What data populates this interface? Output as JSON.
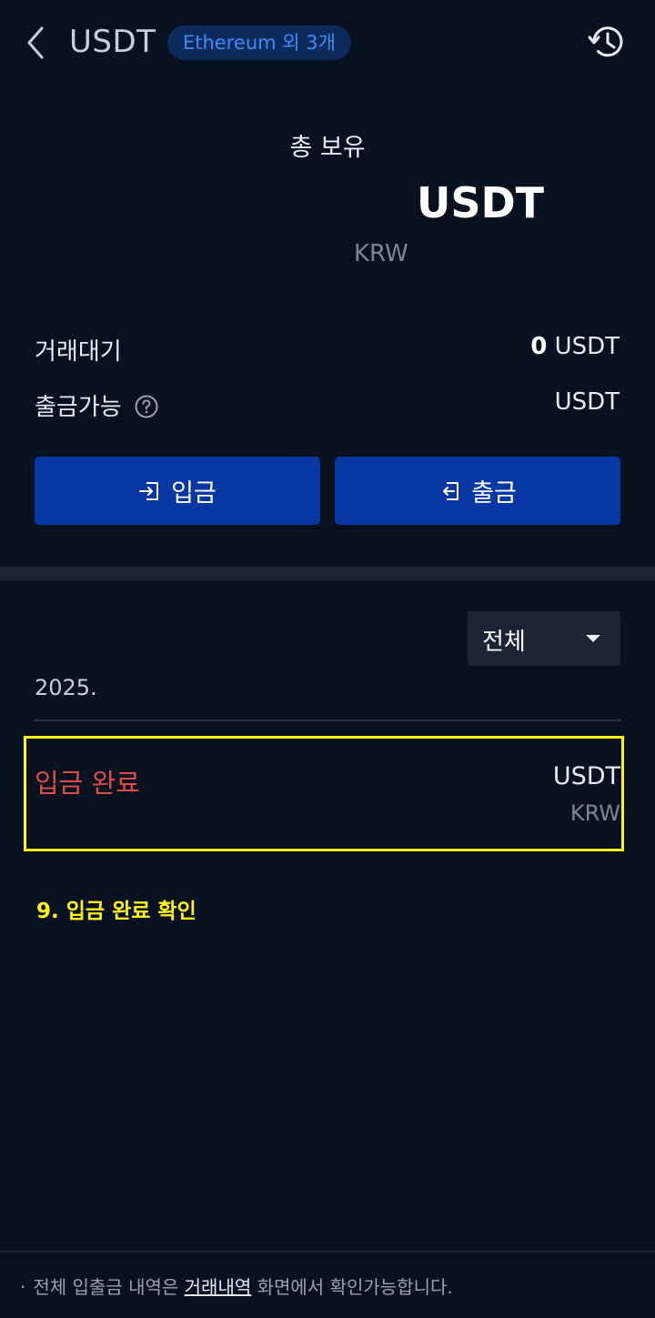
{
  "header": {
    "title": "USDT",
    "network_badge": "Ethereum 외 3개"
  },
  "summary": {
    "total_label": "총 보유",
    "total_unit": "USDT",
    "total_krw_unit": "KRW"
  },
  "balances": {
    "pending_label": "거래대기",
    "pending_amount": "0",
    "pending_unit": "USDT",
    "withdrawable_label": "출금가능",
    "withdrawable_unit": "USDT"
  },
  "actions": {
    "deposit_label": "입금",
    "withdraw_label": "출금"
  },
  "filter": {
    "selected": "전체"
  },
  "history": {
    "date": "2025.",
    "items": [
      {
        "status": "입금 완료",
        "amount_unit": "USDT",
        "krw_unit": "KRW"
      }
    ]
  },
  "annotation": "9. 입금 완료 확인",
  "footer": {
    "note_prefix": "전체 입출금 내역은",
    "link": "거래내역",
    "note_suffix": "화면에서 확인가능합니다."
  },
  "colors": {
    "background": "#07111f",
    "button": "#0637a3",
    "badge_text": "#3d8bf2",
    "status_red": "#e14a4a",
    "highlight": "#fff21a"
  },
  "icons": [
    "chevron-left-icon",
    "history-icon",
    "help-icon",
    "deposit-icon",
    "withdraw-icon",
    "caret-down-icon"
  ]
}
